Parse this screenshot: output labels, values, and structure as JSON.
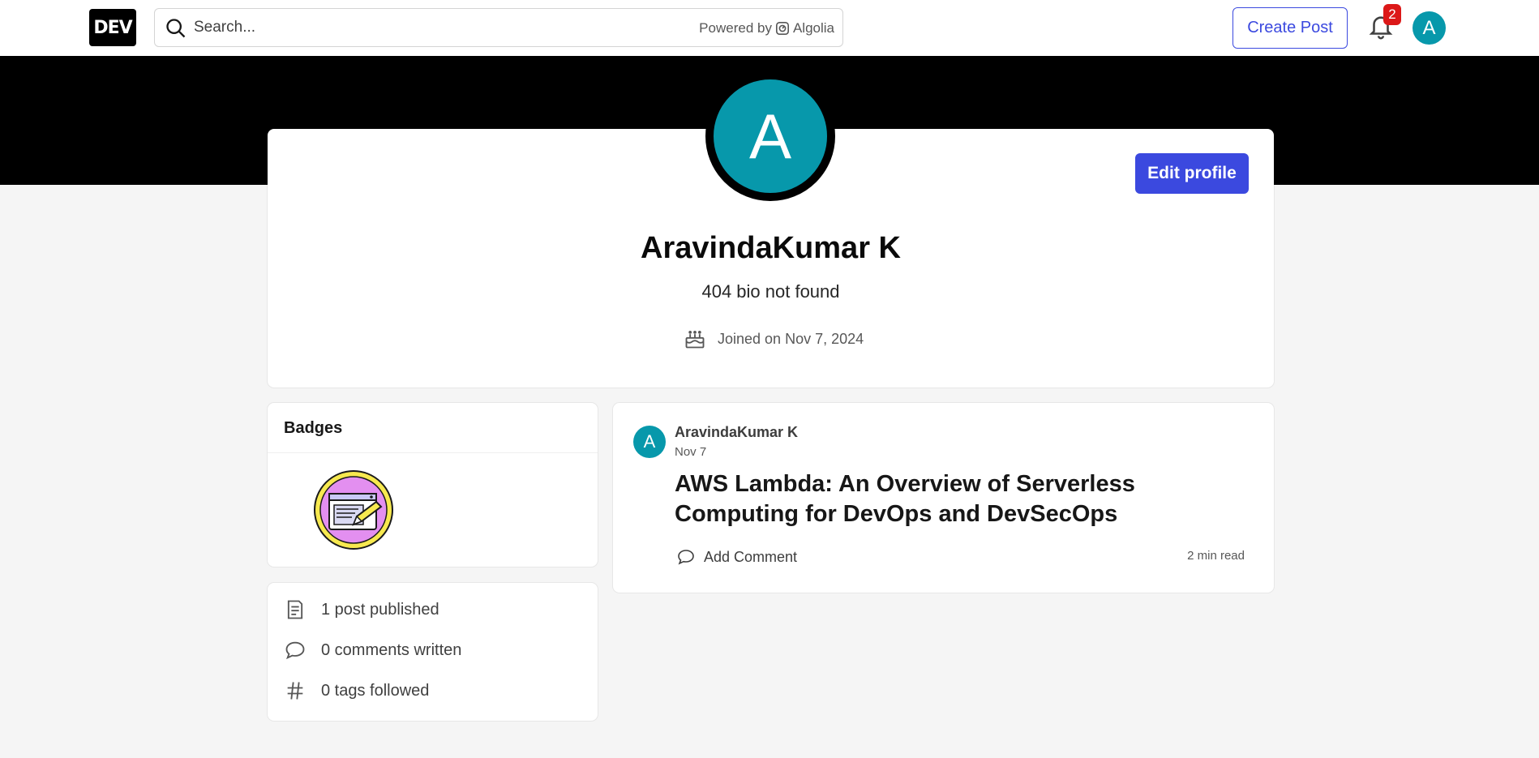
{
  "header": {
    "logo": "DEV",
    "search_placeholder": "Search...",
    "powered_by": "Powered by",
    "algolia": "Algolia",
    "create_post": "Create Post",
    "notification_count": "2",
    "user_initial": "A"
  },
  "profile": {
    "initial": "A",
    "name": "AravindaKumar K",
    "bio": "404 bio not found",
    "joined": "Joined on Nov 7, 2024",
    "edit_button": "Edit profile"
  },
  "badges": {
    "title": "Badges"
  },
  "stats": [
    {
      "icon": "post-icon",
      "text": "1 post published"
    },
    {
      "icon": "comment-icon",
      "text": "0 comments written"
    },
    {
      "icon": "hashtag-icon",
      "text": "0 tags followed"
    }
  ],
  "post": {
    "author_initial": "A",
    "author": "AravindaKumar K",
    "date": "Nov 7",
    "title": "AWS Lambda: An Overview of Serverless Computing for DevOps and DevSecOps",
    "comment_label": "Add Comment",
    "read_time": "2 min read"
  },
  "colors": {
    "accent": "#3b49df",
    "avatar": "#0798ab",
    "badge_red": "#dc1818"
  }
}
